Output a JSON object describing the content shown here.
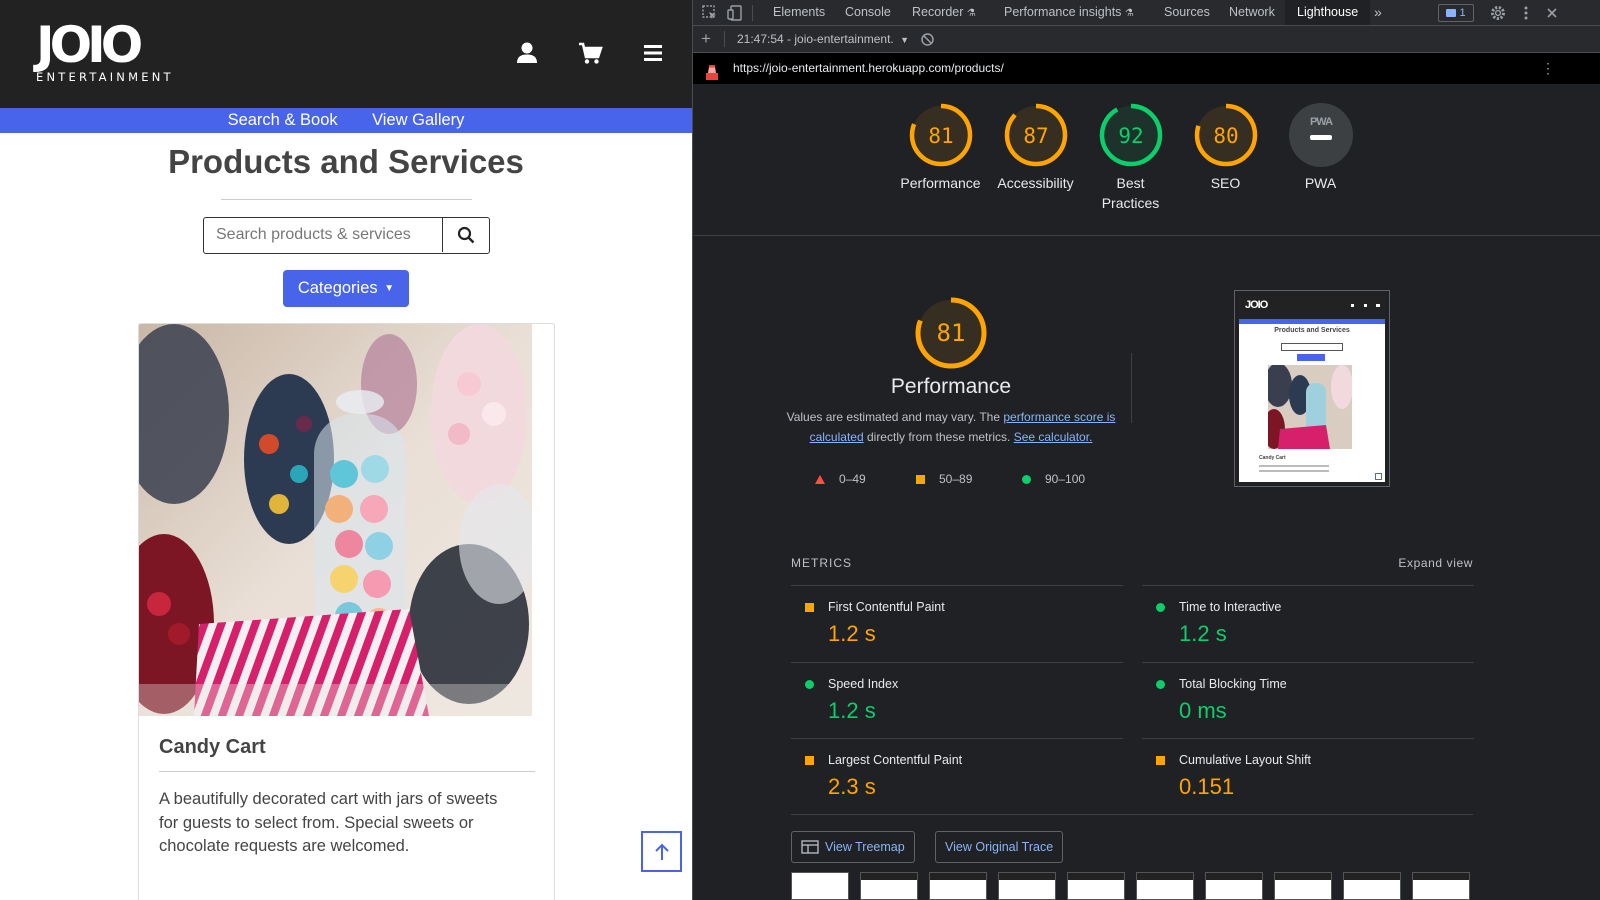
{
  "site": {
    "logo": {
      "main": "JOIO",
      "sub": "ENTERTAINMENT"
    },
    "icons": {
      "account": "user-icon",
      "cart": "cart-icon",
      "menu": "hamburger-icon"
    },
    "nav": [
      "Search & Book",
      "View Gallery"
    ],
    "page_title": "Products and Services",
    "search": {
      "placeholder": "Search products & services",
      "button_icon": "search-icon"
    },
    "categories_label": "Categories",
    "card": {
      "title": "Candy Cart",
      "description": "A beautifully decorated cart with jars of sweets for guests to select from. Special sweets or chocolate requests are welcomed."
    },
    "back_to_top_icon": "arrow-up-icon",
    "colors": {
      "brand_blue": "#4864ea",
      "header_bg": "#222222"
    }
  },
  "devtools": {
    "tabs": [
      "Elements",
      "Console",
      "Recorder",
      "Performance insights",
      "Sources",
      "Network",
      "Lighthouse"
    ],
    "active_tab": "Lighthouse",
    "issues_count": "1",
    "report_selector": "21:47:54 - joio-entertainment.",
    "url": "https://joio-entertainment.herokuapp.com/products/",
    "scores": [
      {
        "label": "Performance",
        "value": "81",
        "score": 81
      },
      {
        "label": "Accessibility",
        "value": "87",
        "score": 87
      },
      {
        "label": "Best Practices",
        "value": "92",
        "score": 92
      },
      {
        "label": "SEO",
        "value": "80",
        "score": 80
      },
      {
        "label": "PWA",
        "value": "PWA",
        "score": null
      }
    ],
    "performance": {
      "score": "81",
      "title": "Performance",
      "note_prefix": "Values are estimated and may vary. The ",
      "note_link1": "performance score is calculated",
      "note_middle": " directly from these metrics. ",
      "note_link2": "See calculator."
    },
    "legend": [
      "0–49",
      "50–89",
      "90–100"
    ],
    "metrics_heading": "METRICS",
    "expand_view": "Expand view",
    "metrics": [
      {
        "name": "First Contentful Paint",
        "value": "1.2 s",
        "status": "average"
      },
      {
        "name": "Time to Interactive",
        "value": "1.2 s",
        "status": "pass"
      },
      {
        "name": "Speed Index",
        "value": "1.2 s",
        "status": "pass"
      },
      {
        "name": "Total Blocking Time",
        "value": "0 ms",
        "status": "pass"
      },
      {
        "name": "Largest Contentful Paint",
        "value": "2.3 s",
        "status": "average"
      },
      {
        "name": "Cumulative Layout Shift",
        "value": "0.151",
        "status": "average"
      }
    ],
    "buttons": {
      "treemap": "View Treemap",
      "trace": "View Original Trace"
    },
    "colors": {
      "pass": "#0cce6b",
      "average": "#ffa400",
      "fail": "#ff4e42",
      "link": "#8ab4f8"
    }
  }
}
